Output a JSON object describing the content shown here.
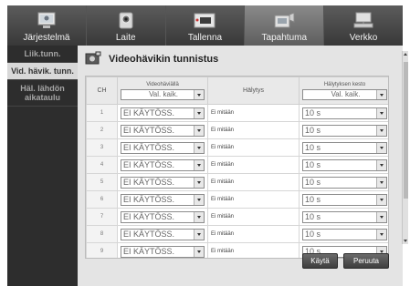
{
  "tabs": [
    {
      "label": "Järjestelmä",
      "icon": "system-monitor-icon",
      "active": false
    },
    {
      "label": "Laite",
      "icon": "camera-icon",
      "active": false
    },
    {
      "label": "Tallenna",
      "icon": "record-icon",
      "active": false
    },
    {
      "label": "Tapahtuma",
      "icon": "event-icon",
      "active": true
    },
    {
      "label": "Verkko",
      "icon": "network-icon",
      "active": false
    }
  ],
  "sidebar": {
    "items": [
      {
        "label": "Liik.tunn.",
        "active": false
      },
      {
        "label": "Vid. hävik. tunn.",
        "active": true
      },
      {
        "label": "Häl. lähdön aikataulu",
        "active": false
      }
    ]
  },
  "page": {
    "title": "Videohävikin tunnistus",
    "title_icon": "camera-alert-icon"
  },
  "table": {
    "col_ch": "CH",
    "col_video_loss": "Videohäviällä",
    "col_alarm": "Hälytys",
    "col_duration": "Hälytyksen kesto",
    "header_video_loss_value": "Val. kaik.",
    "header_duration_value": "Val. kaik.",
    "rows": [
      {
        "ch": "1",
        "video_loss": "EI KÄYTÖSS.",
        "alarm": "Ei mitään",
        "duration": "10 s"
      },
      {
        "ch": "2",
        "video_loss": "EI KÄYTÖSS.",
        "alarm": "Ei mitään",
        "duration": "10 s"
      },
      {
        "ch": "3",
        "video_loss": "EI KÄYTÖSS.",
        "alarm": "Ei mitään",
        "duration": "10 s"
      },
      {
        "ch": "4",
        "video_loss": "EI KÄYTÖSS.",
        "alarm": "Ei mitään",
        "duration": "10 s"
      },
      {
        "ch": "5",
        "video_loss": "EI KÄYTÖSS.",
        "alarm": "Ei mitään",
        "duration": "10 s"
      },
      {
        "ch": "6",
        "video_loss": "EI KÄYTÖSS.",
        "alarm": "Ei mitään",
        "duration": "10 s"
      },
      {
        "ch": "7",
        "video_loss": "EI KÄYTÖSS.",
        "alarm": "Ei mitään",
        "duration": "10 s"
      },
      {
        "ch": "8",
        "video_loss": "EI KÄYTÖSS.",
        "alarm": "Ei mitään",
        "duration": "10 s"
      },
      {
        "ch": "9",
        "video_loss": "EI KÄYTÖSS.",
        "alarm": "Ei mitään",
        "duration": "10 s"
      }
    ]
  },
  "buttons": {
    "apply": "Käytä",
    "cancel": "Peruuta"
  },
  "colors": {
    "tab_bg": "#3a3a3a",
    "tab_active": "#6e6e6e",
    "sidebar_bg": "#2d2d2d",
    "sidebar_active": "#d8d8d8",
    "panel_bg": "#e4e4e4"
  }
}
